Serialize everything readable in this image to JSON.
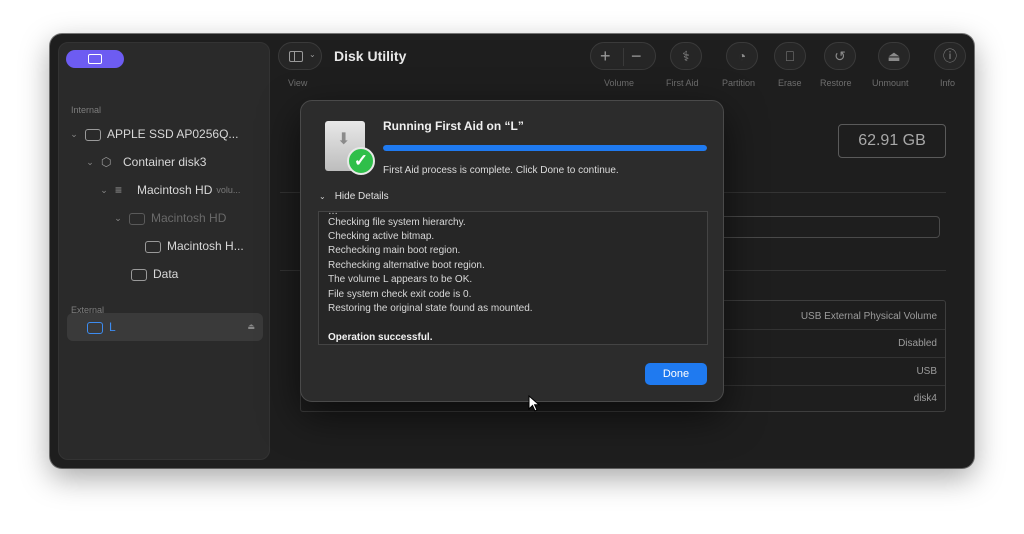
{
  "app": {
    "title": "Disk Utility"
  },
  "toolbar": {
    "view_label": "View",
    "volume_label": "Volume",
    "first_aid_label": "First Aid",
    "partition_label": "Partition",
    "erase_label": "Erase",
    "restore_label": "Restore",
    "unmount_label": "Unmount",
    "info_label": "Info"
  },
  "sidebar": {
    "internal_header": "Internal",
    "external_header": "External",
    "items": [
      {
        "label": "APPLE SSD AP0256Q...",
        "icon": "disk-icon"
      },
      {
        "label": "Container disk3",
        "icon": "container-icon"
      },
      {
        "label": "Macintosh HD",
        "suffix": "volu...",
        "icon": "volume-group-icon"
      },
      {
        "label": "Macintosh HD",
        "icon": "disk-icon"
      },
      {
        "label": "Macintosh H...",
        "icon": "disk-icon"
      },
      {
        "label": "Data",
        "icon": "disk-icon"
      }
    ],
    "external_items": [
      {
        "label": "L",
        "icon": "external-disk-icon",
        "selected": true
      }
    ]
  },
  "detail": {
    "capacity": "62.91 GB",
    "info_values": [
      "USB External Physical Volume",
      "Disabled",
      "USB",
      "disk4"
    ]
  },
  "dialog": {
    "title": "Running First Aid on “L”",
    "progress": 1.0,
    "status": "First Aid process is complete. Click Done to continue.",
    "details_toggle": "Hide Details",
    "log_lines": [
      "Checking file system hierarchy.",
      "Checking active bitmap.",
      "Rechecking main boot region.",
      "Rechecking alternative boot region.",
      "The volume L appears to be OK.",
      "File system check exit code is 0.",
      "Restoring the original state found as mounted."
    ],
    "log_result": "Operation successful.",
    "done_label": "Done"
  },
  "colors": {
    "accent": "#1f7af0",
    "sidebar_pill": "#6d5cf2",
    "success": "#2fbf4a"
  }
}
